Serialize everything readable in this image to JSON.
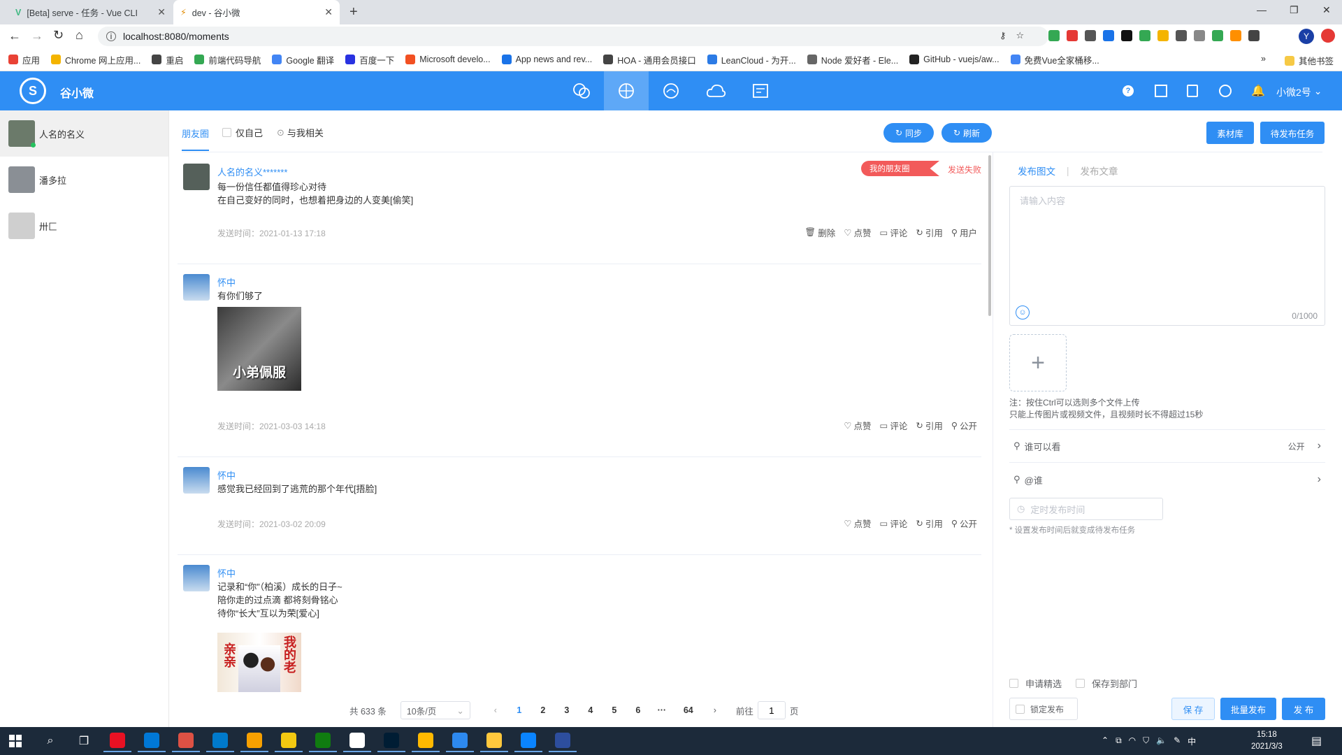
{
  "browser": {
    "tabs": [
      {
        "title": "[Beta] serve - 任务 - Vue CLI"
      },
      {
        "title": "dev - 谷小微"
      }
    ],
    "url": "localhost:8080/moments",
    "bookmarks": [
      {
        "label": "应用",
        "color": "#e94235"
      },
      {
        "label": "Chrome 网上应用...",
        "color": "#f4b400"
      },
      {
        "label": "重启",
        "color": "#444"
      },
      {
        "label": "前端代码导航",
        "color": "#34a853"
      },
      {
        "label": "Google 翻译",
        "color": "#4285f4"
      },
      {
        "label": "百度一下",
        "color": "#2932e1"
      },
      {
        "label": "Microsoft develo...",
        "color": "#f25022"
      },
      {
        "label": "App news and rev...",
        "color": "#1a73e8"
      },
      {
        "label": "HOA - 通用会员接口",
        "color": "#444"
      },
      {
        "label": "LeanCloud - 为开...",
        "color": "#2c7be5"
      },
      {
        "label": "Node 爱好者 - Ele...",
        "color": "#666"
      },
      {
        "label": "GitHub - vuejs/aw...",
        "color": "#222"
      },
      {
        "label": "免费Vue全家桶移...",
        "color": "#4285f4"
      }
    ],
    "other_bookmarks": "其他书签"
  },
  "app": {
    "name": "谷小微",
    "user": "小微2号",
    "nav_icons": [
      "wechat-icon",
      "moments-icon",
      "cloud-chat-icon",
      "cloud-icon",
      "task-board-icon"
    ],
    "header_icons": [
      "help-icon",
      "qrcode-icon",
      "notes-icon",
      "globe-icon",
      "bell-icon"
    ]
  },
  "friends": [
    {
      "name": "人名的名义",
      "color": "#6b7a6a",
      "online": true
    },
    {
      "name": "潘多拉",
      "color": "#8a8f95",
      "online": false
    },
    {
      "name": "卅匚",
      "color": "#cfcfcf",
      "online": false
    }
  ],
  "filters": {
    "tab": "朋友圈",
    "only_self": "仅自己",
    "related": "与我相关",
    "sync": "同步",
    "refresh": "刷新",
    "material": "素材库",
    "pending": "待发布任务"
  },
  "posts": [
    {
      "name": "人名的名义*******",
      "lines": [
        "每一份信任都值得珍心对待",
        "在自己变好的同时，也想着把身边的人变美[偷笑]"
      ],
      "time": "发送时间：2021-01-13 17:18",
      "badge": "我的朋友圈",
      "status": "发送失败",
      "actions": [
        "删除",
        "点赞",
        "评论",
        "引用",
        "用户"
      ],
      "avatar": "#55605a"
    },
    {
      "name": "怀中",
      "lines": [
        "有你们够了"
      ],
      "image_caption": "小弟佩服",
      "time": "发送时间：2021-03-03 14:18",
      "actions": [
        "点赞",
        "评论",
        "引用",
        "公开"
      ],
      "avatar": "#3d78b5"
    },
    {
      "name": "怀中",
      "lines": [
        "感觉我已经回到了逃荒的那个年代[捂脸]"
      ],
      "time": "发送时间：2021-03-02 20:09",
      "actions": [
        "点赞",
        "评论",
        "引用",
        "公开"
      ],
      "avatar": "#3d78b5"
    },
    {
      "name": "怀中",
      "lines": [
        "记录和“你”（柏溪）成长的日子~",
        "陪你走的过点滴 都将刻骨铭心",
        "待你“长大”互以为荣[爱心]"
      ],
      "image_caption_left": "亲亲",
      "image_caption_right": "我的老",
      "actions": [],
      "avatar": "#3d78b5"
    }
  ],
  "pagination": {
    "total": "共 633 条",
    "page_size": "10条/页",
    "pages": [
      "1",
      "2",
      "3",
      "4",
      "5",
      "6",
      "···",
      "64"
    ],
    "goto_prefix": "前往",
    "goto_value": "1",
    "goto_suffix": "页"
  },
  "composer": {
    "tab_image": "发布图文",
    "tab_article": "发布文章",
    "placeholder": "请输入内容",
    "counter": "0/1000",
    "note1": "注：按住Ctrl可以选则多个文件上传",
    "note2": "只能上传图片或视频文件，且视频时长不得超过15秒",
    "visibility_label": "谁可以看",
    "visibility_value": "公开",
    "mention_label": "@谁",
    "schedule_placeholder": "定时发布时间",
    "schedule_note": "* 设置发布时间后就变成待发布任务",
    "apply_featured": "申请精选",
    "save_dept": "保存到部门",
    "lock_publish": "锁定发布",
    "save": "保 存",
    "batch": "批量发布",
    "publish": "发 布"
  },
  "taskbar": {
    "time": "15:18",
    "date": "2021/3/3",
    "ime": "中",
    "apps": [
      "#e81123",
      "#0078d7",
      "#dd5144",
      "#007acc",
      "#f7a000",
      "#f2c811",
      "#107c10",
      "#fff",
      "#001d34",
      "#ffb900",
      "#2d89ef",
      "#ffc83d",
      "#0a84ff",
      "#2d4e9e"
    ]
  }
}
